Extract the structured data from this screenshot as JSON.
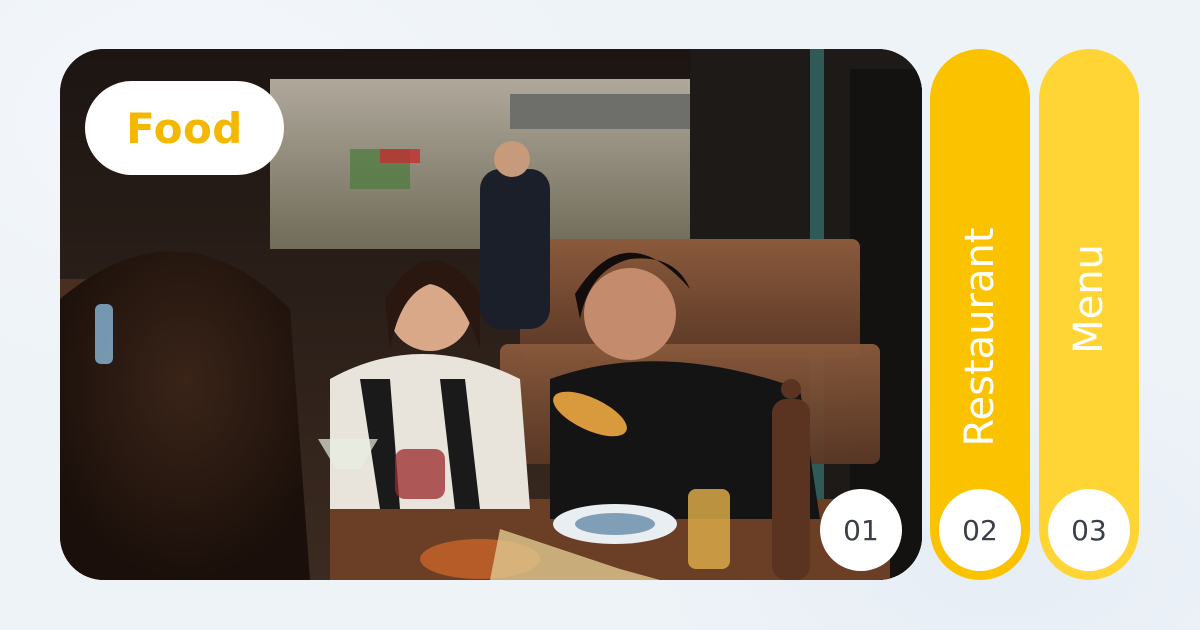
{
  "slides": [
    {
      "number": "01",
      "label": "Food",
      "state": "expanded",
      "image": "friends-eating-restaurant-photo"
    },
    {
      "number": "02",
      "label": "Restaurant",
      "state": "collapsed"
    },
    {
      "number": "03",
      "label": "Menu",
      "state": "collapsed"
    }
  ],
  "colors": {
    "background": "#eef3f8",
    "accent_yellow": "#fbc200",
    "light_yellow": "#ffd535",
    "badge_text": "#3a3f4a",
    "pill_text": "#f5b800"
  }
}
